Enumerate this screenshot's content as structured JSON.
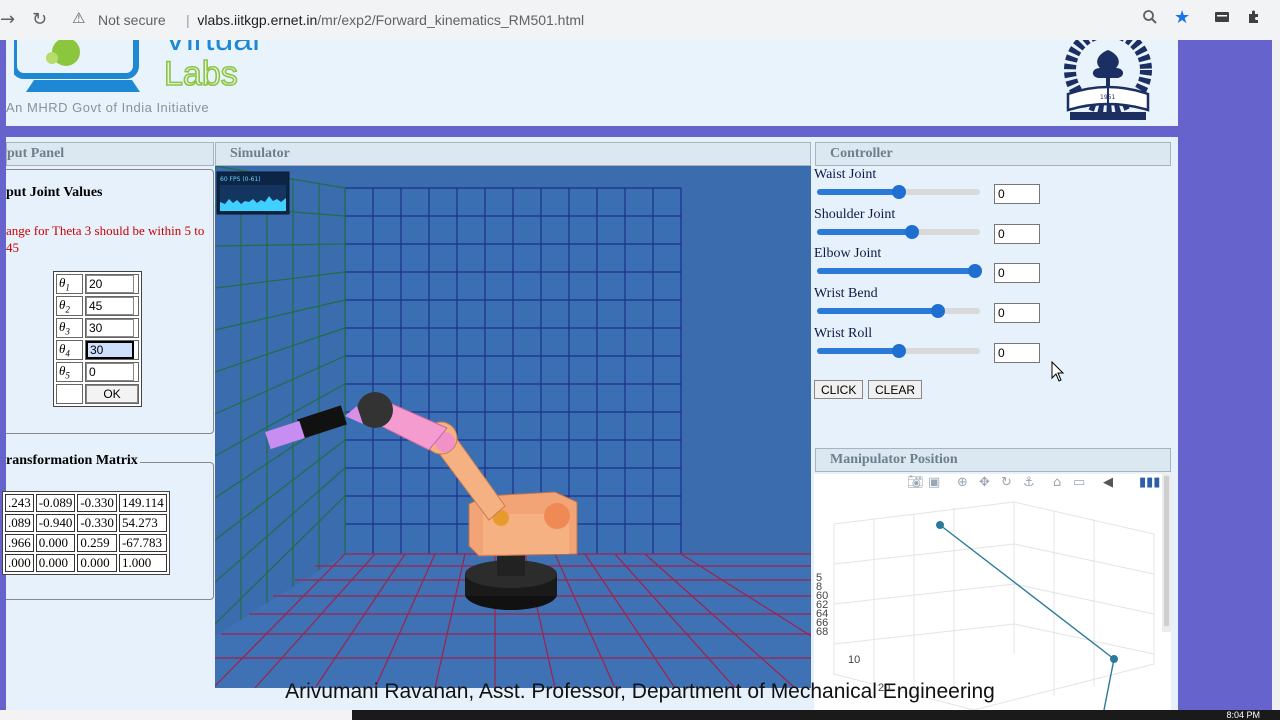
{
  "browser": {
    "security_label": "Not secure",
    "url_host": "vlabs.iitkgp.ernet.in",
    "url_path": "/mr/exp2/Forward_kinematics_RM501.html"
  },
  "header": {
    "tagline": "An MHRD Govt of India Initiative",
    "logo_text_top": "Virtual",
    "logo_text_bottom": "Labs",
    "iit_year": "1951"
  },
  "input_panel": {
    "title": "put Panel",
    "legend": "put Joint Values",
    "warning": "ange for Theta 3 should be within 5 to 45",
    "joints": [
      {
        "label": "θ",
        "sub": "1",
        "value": "20"
      },
      {
        "label": "θ",
        "sub": "2",
        "value": "45"
      },
      {
        "label": "θ",
        "sub": "3",
        "value": "30"
      },
      {
        "label": "θ",
        "sub": "4",
        "value": "30"
      },
      {
        "label": "θ",
        "sub": "5",
        "value": "0"
      }
    ],
    "ok_label": "OK"
  },
  "transformation": {
    "legend": "ransformation Matrix",
    "rows": [
      [
        ".243",
        "-0.089",
        "-0.330",
        "149.114"
      ],
      [
        ".089",
        "-0.940",
        "-0.330",
        "54.273"
      ],
      [
        ".966",
        "0.000",
        "0.259",
        "-67.783"
      ],
      [
        ".000",
        "0.000",
        "0.000",
        "1.000"
      ]
    ]
  },
  "simulator": {
    "title": "Simulator",
    "fps_label": "60 FPS (0-61)"
  },
  "controller": {
    "title": "Controller",
    "joints": [
      {
        "name": "Waist Joint",
        "value": "0",
        "level": 0.5
      },
      {
        "name": "Shoulder Joint",
        "value": "0",
        "level": 0.58
      },
      {
        "name": "Elbow Joint",
        "value": "0",
        "level": 0.97
      },
      {
        "name": "Wrist Bend",
        "value": "0",
        "level": 0.74
      },
      {
        "name": "Wrist Roll",
        "value": "0",
        "level": 0.5
      }
    ],
    "click_label": "CLICK",
    "clear_label": "CLEAR"
  },
  "manipulator": {
    "title": "Manipulator Position",
    "axis_ticks": [
      "5",
      "8",
      "60",
      "62",
      "64",
      "66",
      "68"
    ],
    "label_10": "10",
    "label_20": "20"
  },
  "footer": {
    "credit": "Arivumani Ravanan, Asst. Professor, Department of Mechanical Engineering"
  },
  "taskbar": {
    "clock": "8:04 PM"
  },
  "colors": {
    "page_bg": "#6663cc",
    "sim_bg": "#3a6cae",
    "slider_blue": "#2a7bd8",
    "warning_red": "#cc0000"
  }
}
